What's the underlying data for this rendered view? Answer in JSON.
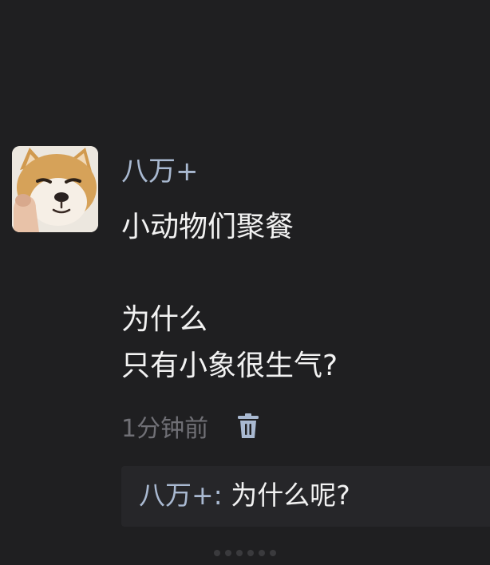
{
  "post": {
    "author": "八万+",
    "content_lines": [
      "小动物们聚餐",
      "",
      "为什么",
      "只有小象很生气?"
    ],
    "timestamp": "1分钟前"
  },
  "reply": {
    "author": "八万+",
    "separator": ": ",
    "text": "为什么呢?"
  },
  "icons": {
    "avatar": "shiba-dog-avatar",
    "delete": "trash-icon"
  },
  "colors": {
    "background": "#1f1f21",
    "username": "#a9b9d1",
    "text": "#f2f2f2",
    "muted": "#707076",
    "reply_background": "#262629"
  }
}
